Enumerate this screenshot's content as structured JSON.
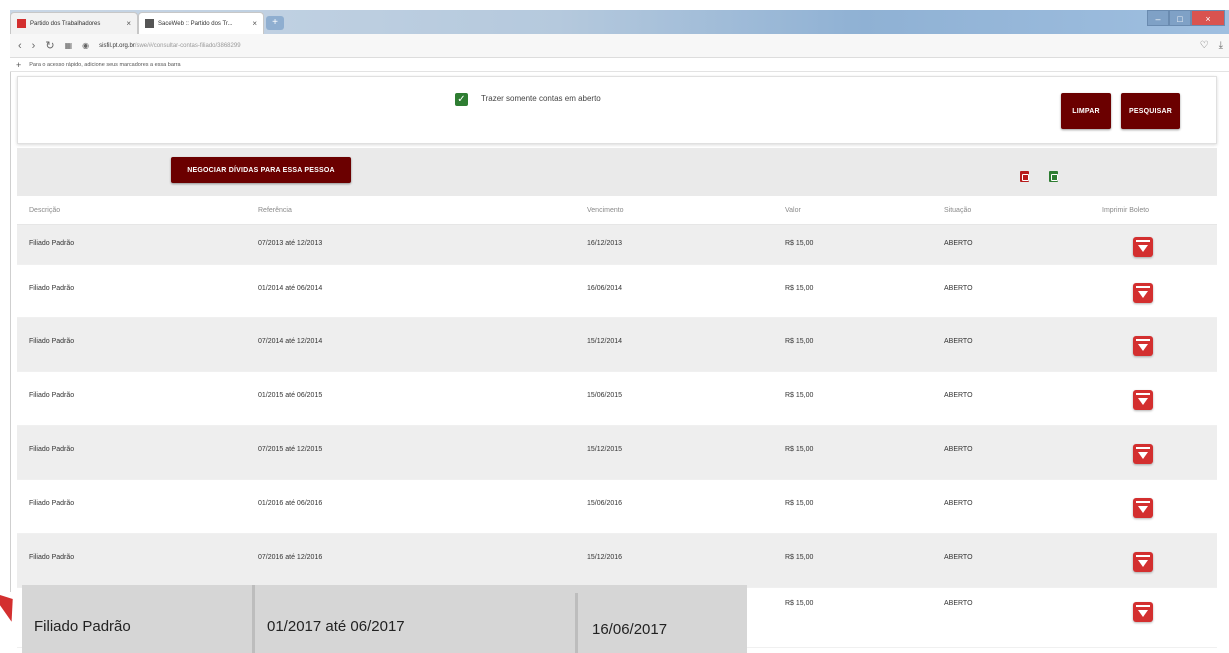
{
  "browser": {
    "tabs": [
      {
        "label": "Partido dos Trabalhadores",
        "active": false
      },
      {
        "label": "SaceWeb :: Partido dos Tr...",
        "active": true
      }
    ],
    "new_tab_label": "+",
    "address": {
      "host": "sisfil.pt.org.br",
      "path": "/swe/#/consultar-contas-filiado/3868299"
    },
    "bookmarks_hint": "Para o acesso rápido, adicione seus marcadores a essa barra"
  },
  "filter": {
    "checkbox_label": "Trazer somente contas em aberto",
    "checked": true,
    "limpar_label": "LIMPAR",
    "pesquisar_label": "PESQUISAR"
  },
  "actions": {
    "negociar_label": "NEGOCIAR DÍVIDAS PARA ESSA PESSOA",
    "export_icons": [
      "pdf-icon",
      "excel-icon"
    ]
  },
  "table": {
    "headers": [
      "Descrição",
      "Referência",
      "Vencimento",
      "Valor",
      "Situação",
      "Imprimir Boleto"
    ],
    "rows": [
      {
        "descricao": "Filiado Padrão",
        "referencia": "07/2013 até 12/2013",
        "vencimento": "16/12/2013",
        "valor": "R$ 15,00",
        "situacao": "ABERTO"
      },
      {
        "descricao": "Filiado Padrão",
        "referencia": "01/2014 até 06/2014",
        "vencimento": "16/06/2014",
        "valor": "R$ 15,00",
        "situacao": "ABERTO"
      },
      {
        "descricao": "Filiado Padrão",
        "referencia": "07/2014 até 12/2014",
        "vencimento": "15/12/2014",
        "valor": "R$ 15,00",
        "situacao": "ABERTO"
      },
      {
        "descricao": "Filiado Padrão",
        "referencia": "01/2015 até 06/2015",
        "vencimento": "15/06/2015",
        "valor": "R$ 15,00",
        "situacao": "ABERTO"
      },
      {
        "descricao": "Filiado Padrão",
        "referencia": "07/2015 até 12/2015",
        "vencimento": "15/12/2015",
        "valor": "R$ 15,00",
        "situacao": "ABERTO"
      },
      {
        "descricao": "Filiado Padrão",
        "referencia": "01/2016 até 06/2016",
        "vencimento": "15/06/2016",
        "valor": "R$ 15,00",
        "situacao": "ABERTO"
      },
      {
        "descricao": "Filiado Padrão",
        "referencia": "07/2016 até 12/2016",
        "vencimento": "15/12/2016",
        "valor": "R$ 15,00",
        "situacao": "ABERTO"
      },
      {
        "descricao": "Filiado Padrão",
        "referencia": "01/2017 até 06/2017",
        "vencimento": "16/06/2017",
        "valor": "R$ 15,00",
        "situacao": "ABERTO"
      }
    ]
  },
  "colors": {
    "accent_dark_red": "#6b0000",
    "download_red": "#d32f2f",
    "check_green": "#2e7d32"
  }
}
